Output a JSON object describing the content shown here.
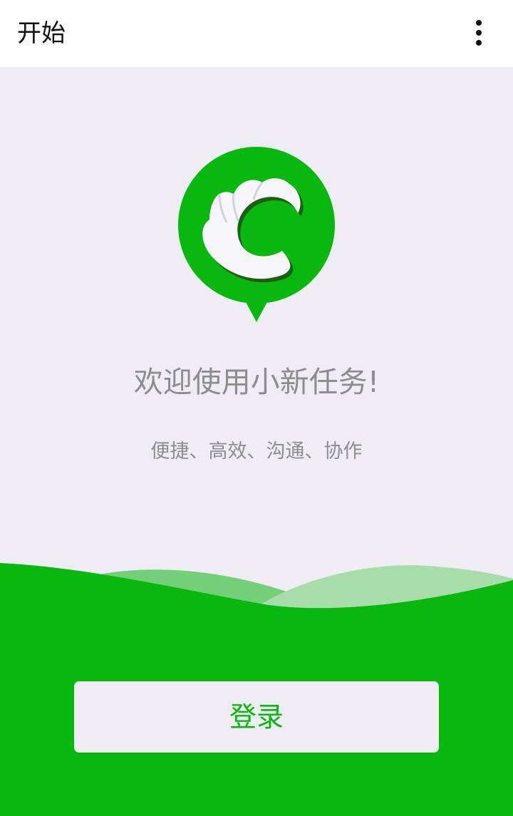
{
  "app_bar": {
    "title": "开始",
    "menu_icon": "more-vertical-icon"
  },
  "logo": {
    "icon": "chat-bubble-c-logo",
    "color": "#09b80f"
  },
  "hero": {
    "welcome": "欢迎使用小新任务!",
    "tagline": "便捷、高效、沟通、协作"
  },
  "actions": {
    "login_label": "登录"
  },
  "colors": {
    "brand_green": "#09b80f",
    "background": "#efedf3",
    "text_gray": "#8d8d8d"
  }
}
